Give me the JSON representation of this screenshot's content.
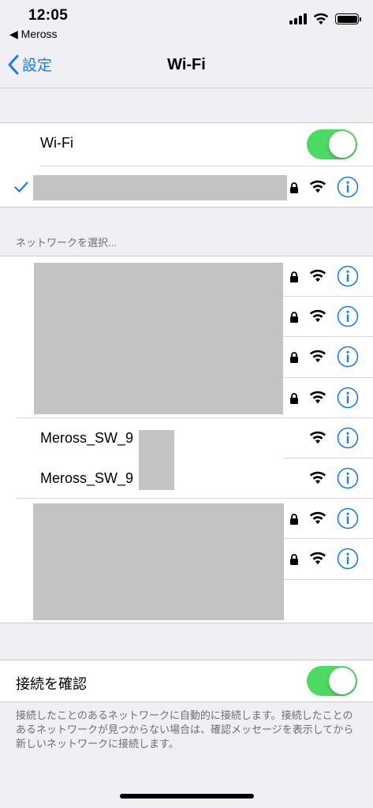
{
  "status": {
    "time": "12:05",
    "back_app": "◀ Meross"
  },
  "nav": {
    "back_label": "設定",
    "title": "Wi-Fi"
  },
  "wifi_toggle": {
    "label": "Wi-Fi",
    "on": true
  },
  "section_header": "ネットワークを選択...",
  "networks": [
    {
      "name": "Meross_SW_9",
      "secured": false
    },
    {
      "name": "Meross_SW_9",
      "secured": false
    }
  ],
  "ask_to_join": {
    "label": "接続を確認",
    "on": true,
    "description": "接続したことのあるネットワークに自動的に接続します。接続したことのあるネットワークが見つからない場合は、確認メッセージを表示してから新しいネットワークに接続します。"
  },
  "colors": {
    "accent": "#1a7cf5",
    "toggle_on": "#4cd964",
    "redaction": "#c3c3c3"
  }
}
